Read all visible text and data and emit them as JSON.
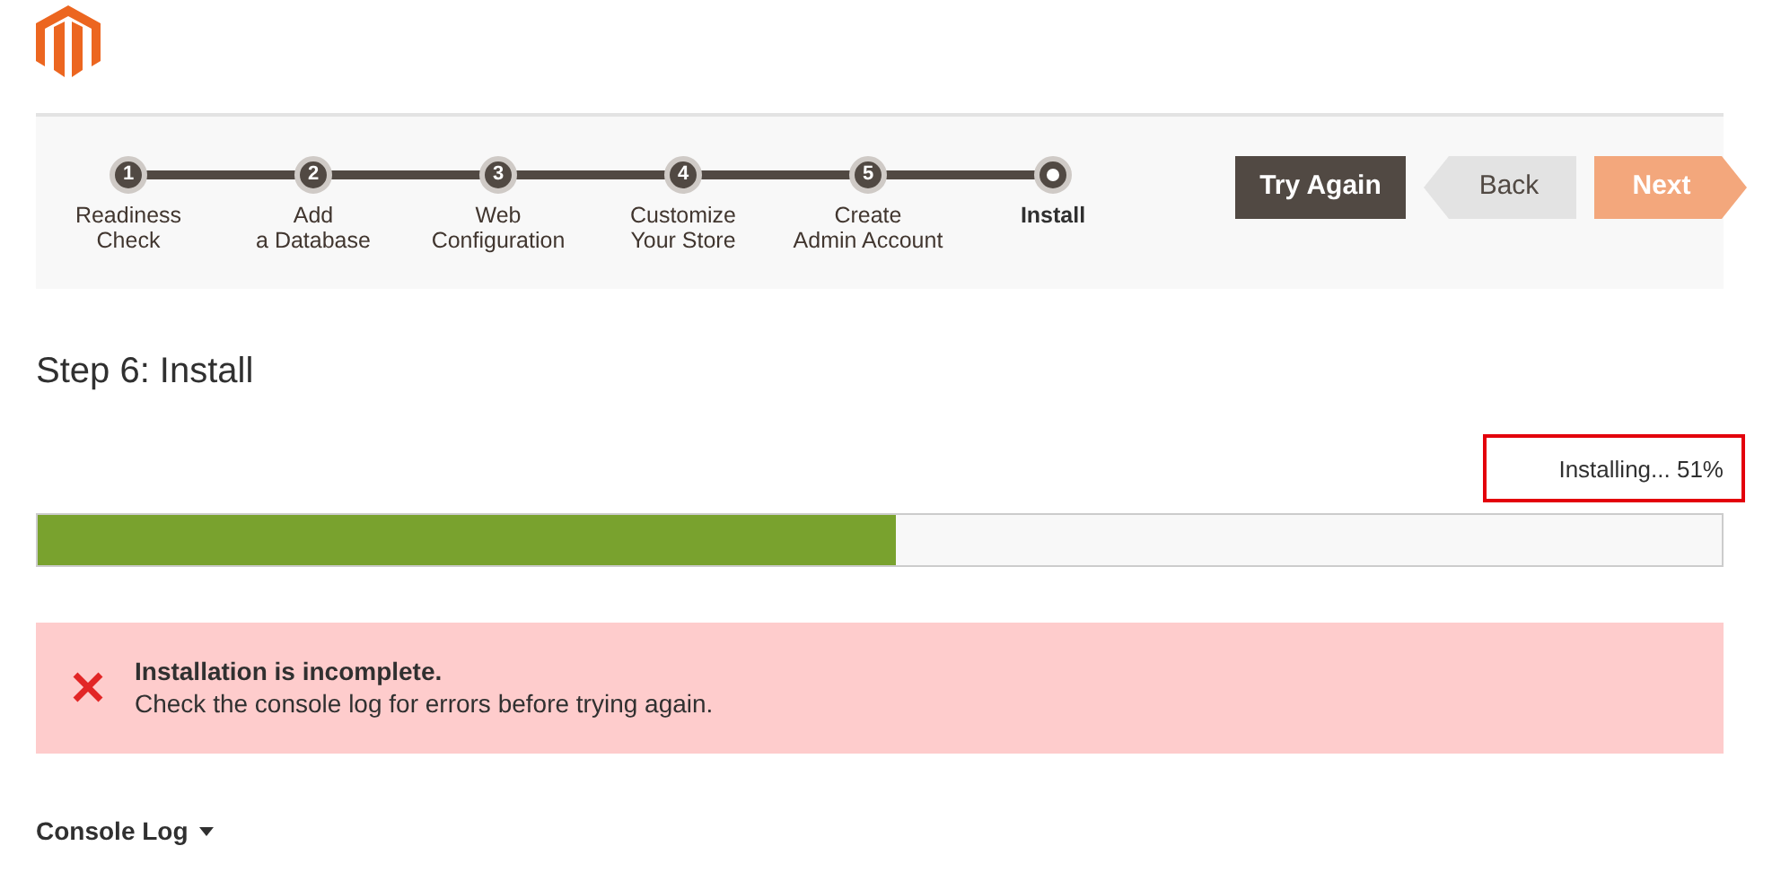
{
  "steps": [
    {
      "number": "1",
      "label_lines": [
        "Readiness",
        "Check"
      ],
      "selected": false
    },
    {
      "number": "2",
      "label_lines": [
        "Add",
        "a Database"
      ],
      "selected": false
    },
    {
      "number": "3",
      "label_lines": [
        "Web",
        "Configuration"
      ],
      "selected": false
    },
    {
      "number": "4",
      "label_lines": [
        "Customize",
        "Your Store"
      ],
      "selected": false
    },
    {
      "number": "5",
      "label_lines": [
        "Create",
        "Admin Account"
      ],
      "selected": false
    },
    {
      "label_lines": [
        "Install"
      ],
      "selected": true
    }
  ],
  "buttons": [
    {
      "label": "Try Again",
      "kind": "primary"
    },
    {
      "label": "Back",
      "kind": "back"
    },
    {
      "label": "Next",
      "kind": "next"
    }
  ],
  "title": "Step 6: Install",
  "progress": {
    "status": "Installing... 51%",
    "highlighted": true,
    "level": 0.51
  },
  "alert": {
    "heading": "Installation is incomplete.",
    "message": "Check the console log for errors before trying again."
  },
  "console_log": {
    "label": "Console Log",
    "expanded": false
  }
}
